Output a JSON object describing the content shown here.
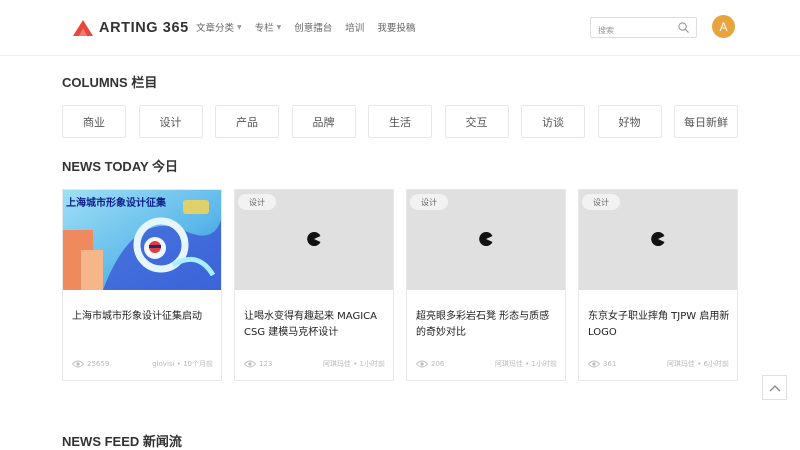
{
  "header": {
    "logo_text": "ARTING 365",
    "nav": [
      {
        "label": "文章分类",
        "caret": true
      },
      {
        "label": "专栏",
        "caret": true
      },
      {
        "label": "创意擂台",
        "caret": false
      },
      {
        "label": "培训",
        "caret": false
      },
      {
        "label": "我要投稿",
        "caret": false
      }
    ],
    "search_placeholder": "搜索",
    "avatar_letter": "A",
    "avatar_color": "#e8a33d",
    "brand_color": "#e8483b"
  },
  "columns": {
    "title": "COLUMNS 栏目",
    "items": [
      "商业",
      "设计",
      "产品",
      "品牌",
      "生活",
      "交互",
      "访谈",
      "好物",
      "每日新鲜"
    ]
  },
  "news_today": {
    "title": "NEWS TODAY 今日",
    "cards": [
      {
        "tag": "",
        "title": "上海市城市形象设计征集启动",
        "views": "25659",
        "author": "glovisi",
        "time": "10个月前",
        "image_text": "上海城市形象设计征集",
        "has_image": true
      },
      {
        "tag": "设计",
        "title": "让喝水变得有趣起来 MAGICA CSG 建模马克杯设计",
        "views": "123",
        "author": "阿琪玛佳",
        "time": "1小时前",
        "has_image": false
      },
      {
        "tag": "设计",
        "title": "超亮眼多彩岩石凳 形态与质感的奇妙对比",
        "views": "206",
        "author": "阿琪玛佳",
        "time": "1小时前",
        "has_image": false
      },
      {
        "tag": "设计",
        "title": "东京女子职业摔角 TJPW 启用新 LOGO",
        "views": "361",
        "author": "阿琪玛佳",
        "time": "6小时前",
        "has_image": false
      }
    ]
  },
  "news_feed": {
    "title": "NEWS FEED 新闻流"
  },
  "meta_separator": " • "
}
